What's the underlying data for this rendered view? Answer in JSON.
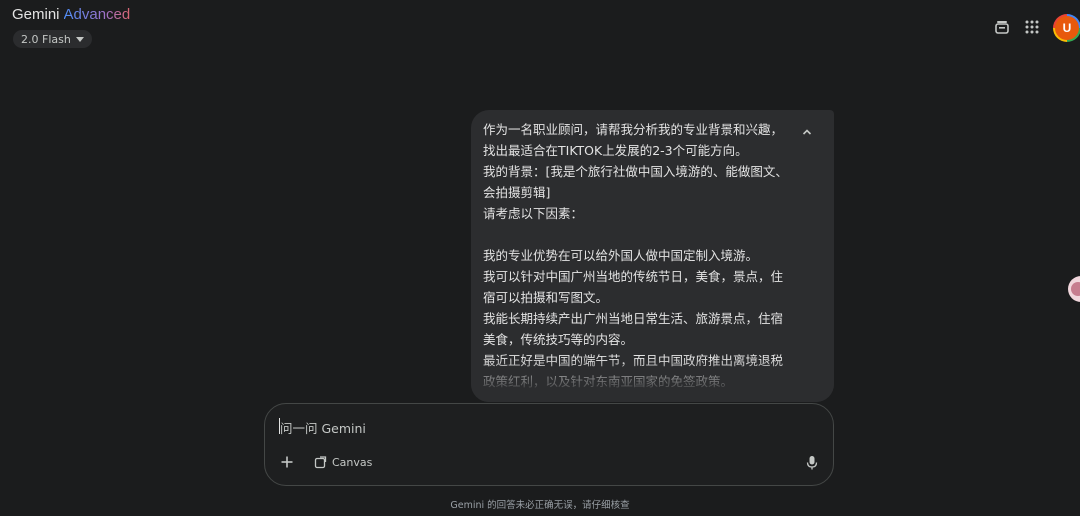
{
  "header": {
    "brand_primary": "Gemini",
    "brand_secondary": "Advanced",
    "model_label": "2.0 Flash",
    "avatar_letter": "U",
    "icons": [
      "chat-history-icon",
      "apps-grid-icon"
    ]
  },
  "message": {
    "lines": [
      "作为一名职业顾问，请帮我分析我的专业背景和兴趣，找出最适合在TIKTOK上发展的2-3个可能方向。",
      "我的背景：[我是个旅行社做中国入境游的、能做图文、会拍摄剪辑]",
      "请考虑以下因素：",
      "",
      "我的专业优势在可以给外国人做中国定制入境游。",
      "我可以针对中国广州当地的传统节日，美食，景点，住宿可以拍摄和写图文。",
      "我能长期持续产出广州当地日常生活、旅游景点，住宿美食，传统技巧等的内容。",
      "最近正好是中国的端午节，而且中国政府推出离境退税政策红利，以及针对东南亚国家的免签政策。"
    ]
  },
  "composer": {
    "placeholder": "问一问 Gemini",
    "canvas_label": "Canvas"
  },
  "footer": {
    "disclaimer": "Gemini 的回答未必正确无误，请仔细核查"
  },
  "colors": {
    "background": "#1b1c1d",
    "bubble": "#2c2d2f",
    "avatar": "#e8590c"
  }
}
